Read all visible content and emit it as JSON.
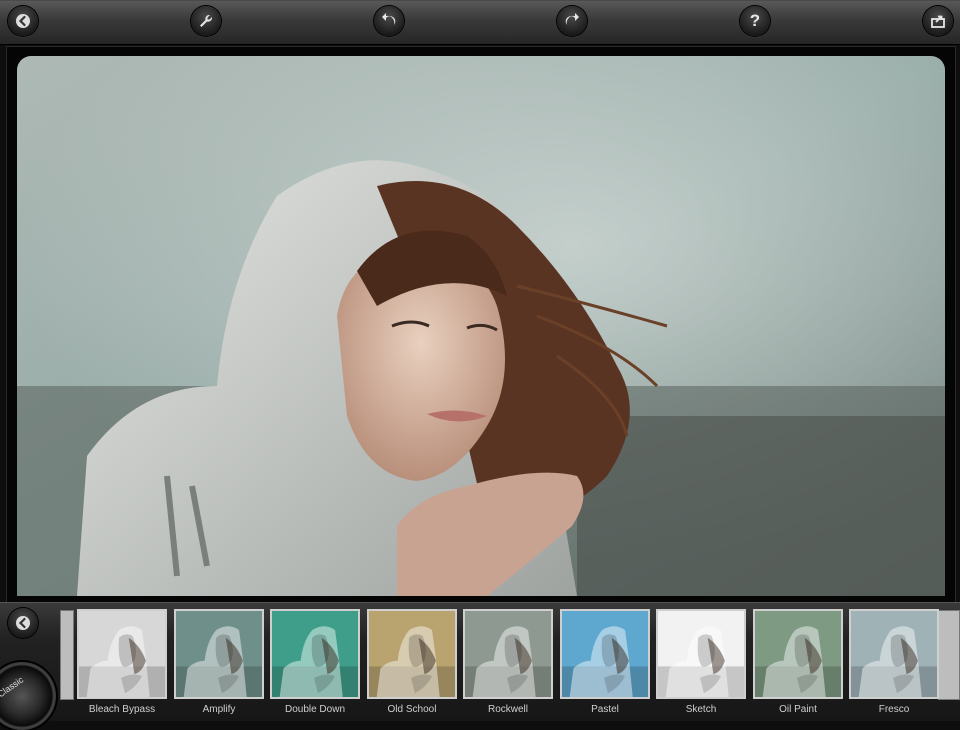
{
  "toolbar": {
    "buttons": [
      {
        "name": "back-icon"
      },
      {
        "name": "wrench-icon"
      },
      {
        "name": "undo-icon"
      },
      {
        "name": "redo-icon"
      },
      {
        "name": "help-icon",
        "label": "?"
      },
      {
        "name": "share-icon"
      }
    ]
  },
  "strip": {
    "back_icon": "chevron-left-icon",
    "dial_label": "Classic"
  },
  "filters": [
    {
      "label": "Bleach Bypass",
      "tint": "#d7d7d7",
      "tone": "mono"
    },
    {
      "label": "Amplify",
      "tint": "#6f8f8a",
      "tone": "teal"
    },
    {
      "label": "Double Down",
      "tint": "#3f9e8a",
      "tone": "green"
    },
    {
      "label": "Old School",
      "tint": "#b9a36f",
      "tone": "sepia"
    },
    {
      "label": "Rockwell",
      "tint": "#8e9991",
      "tone": "muted"
    },
    {
      "label": "Pastel",
      "tint": "#5ea7cf",
      "tone": "blue"
    },
    {
      "label": "Sketch",
      "tint": "#f2f2f2",
      "tone": "white"
    },
    {
      "label": "Oil Paint",
      "tint": "#7e9a83",
      "tone": "oil"
    },
    {
      "label": "Fresco",
      "tint": "#9fb3b7",
      "tone": "cool"
    }
  ]
}
